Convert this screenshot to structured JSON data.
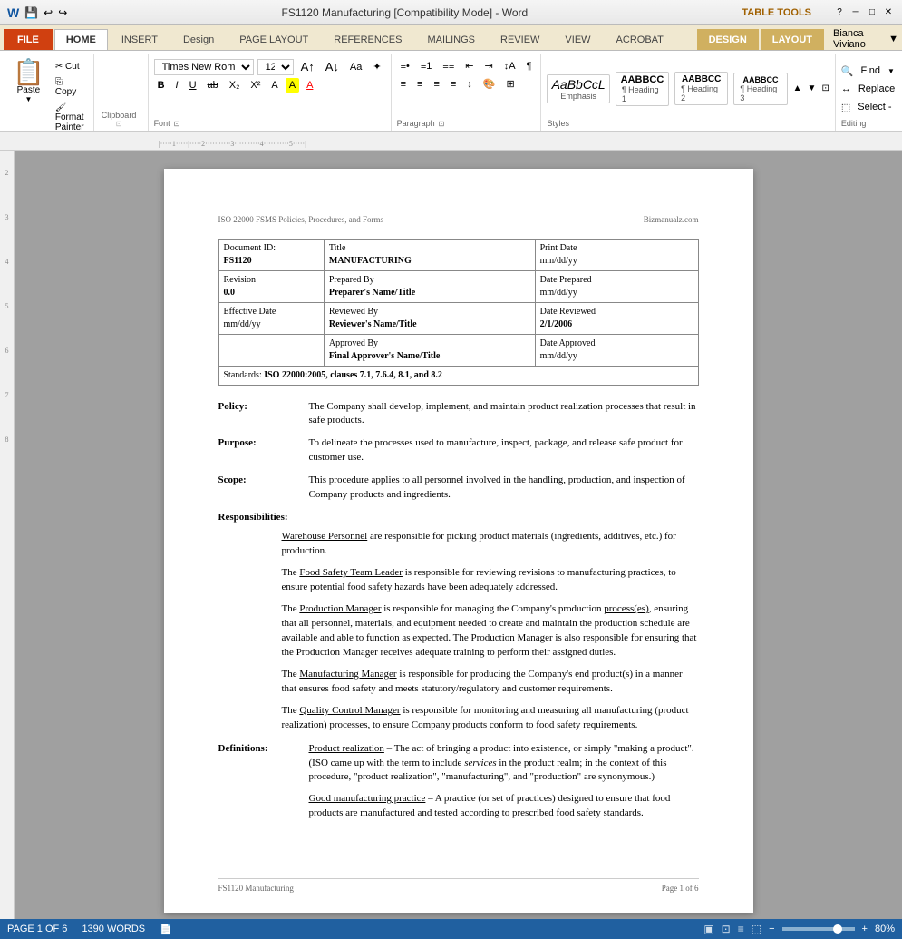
{
  "titlebar": {
    "title": "FS1120 Manufacturing [Compatibility Mode] - Word",
    "table_tools": "TABLE TOOLS"
  },
  "tabs": {
    "file": "FILE",
    "home": "HOME",
    "insert": "INSERT",
    "design": "Design",
    "page_layout": "PAGE LAYOUT",
    "references": "REFERENCES",
    "mailings": "MAILINGS",
    "review": "REVIEW",
    "view": "VIEW",
    "acrobat": "ACROBAT",
    "table_design": "DESIGN",
    "table_layout": "LAYOUT"
  },
  "ribbon": {
    "clipboard": {
      "label": "Clipboard",
      "paste": "Paste",
      "cut": "Cut",
      "copy": "Copy",
      "format_painter": "Format Painter"
    },
    "font": {
      "label": "Font",
      "name": "Times New Roman",
      "size": "12",
      "bold": "B",
      "italic": "I",
      "underline": "U"
    },
    "paragraph": {
      "label": "Paragraph"
    },
    "styles": {
      "label": "Styles",
      "emphasis_label": "Emphasis",
      "heading1_label": "¶ Heading 1",
      "heading2_label": "¶ Heading 2",
      "heading3_label": "¶ Heading 3",
      "emphasis_preview": "AaBbCcL",
      "heading1_preview": "AABBCC",
      "heading2_preview": "AABBCC",
      "heading3_preview": "AABBCC"
    },
    "editing": {
      "label": "Editing",
      "find": "Find",
      "replace": "Replace",
      "select": "Select -"
    }
  },
  "document": {
    "header_left": "ISO 22000 FSMS Policies, Procedures, and Forms",
    "header_right": "Bizmanualz.com",
    "table": {
      "doc_id_label": "Document ID:",
      "doc_id_value": "FS1120",
      "title_label": "Title",
      "title_value": "MANUFACTURING",
      "print_date_label": "Print Date",
      "print_date_value": "mm/dd/yy",
      "revision_label": "Revision",
      "revision_value": "0.0",
      "prepared_by_label": "Prepared By",
      "preparer_label": "Preparer's Name/Title",
      "date_prepared_label": "Date Prepared",
      "date_prepared_value": "mm/dd/yy",
      "effective_date_label": "Effective Date",
      "effective_date_value": "mm/dd/yy",
      "reviewed_by_label": "Reviewed By",
      "reviewer_label": "Reviewer's Name/Title",
      "date_reviewed_label": "Date Reviewed",
      "date_reviewed_value": "2/1/2006",
      "approved_by_label": "Approved By",
      "approver_label": "Final Approver's Name/Title",
      "date_approved_label": "Date Approved",
      "date_approved_value": "mm/dd/yy",
      "standards_label": "Standards:",
      "standards_value": "ISO 22000:2005, clauses 7.1, 7.6.4, 8.1, and 8.2"
    },
    "policy": {
      "label": "Policy:",
      "text": "The Company shall develop, implement, and maintain product realization processes that result in safe products."
    },
    "purpose": {
      "label": "Purpose:",
      "text": "To delineate the processes used to manufacture, inspect, package, and release safe product for customer use."
    },
    "scope": {
      "label": "Scope:",
      "text": "This procedure applies to all personnel involved in the handling, production, and inspection of Company products and ingredients."
    },
    "responsibilities": {
      "label": "Responsibilities:",
      "warehouse": "Warehouse Personnel",
      "warehouse_text": " are responsible for picking product materials (ingredients, additives, etc.) for production.",
      "fst_intro": "The ",
      "fst_name": "Food Safety Team Leader",
      "fst_text": " is responsible for reviewing revisions to manufacturing practices, to ensure potential food safety hazards have been adequately addressed.",
      "pm_intro": "The ",
      "pm_name": "Production Manager",
      "pm_text1": " is responsible for managing the Company's production ",
      "pm_process": "process(es)",
      "pm_text2": ", ensuring that all personnel, materials, and equipment needed to create and maintain the production schedule are available and able to function as expected.  The Production Manager is also responsible for ensuring that the Production Manager receives adequate training to perform their assigned duties.",
      "mm_intro": "The ",
      "mm_name": "Manufacturing Manager",
      "mm_text": " is responsible for producing the Company's end product(s) in a manner that ensures food safety and meets statutory/regulatory and customer requirements.",
      "qcm_intro": "The ",
      "qcm_name": "Quality Control Manager",
      "qcm_text": " is responsible for monitoring and measuring all manufacturing (product realization) processes, to ensure Company products conform to food safety requirements."
    },
    "definitions": {
      "label": "Definitions:",
      "pr_term": "Product realization",
      "pr_text": " – The act of bringing a product into existence, or simply \"making a product\".  (ISO came up with the term to include ",
      "pr_italic": "services",
      "pr_text2": " in the product realm; in the context of this procedure, \"product realization\", \"manufacturing\", and \"production\" are synonymous.)",
      "gmp_term": "Good manufacturing practice",
      "gmp_text": " – A practice (or set of practices) designed to ensure that food products are manufactured and tested according to prescribed food safety standards."
    },
    "footer_left": "FS1120  Manufacturing",
    "footer_right": "Page 1 of 6"
  },
  "statusbar": {
    "page_info": "PAGE 1 OF 6",
    "word_count": "1390 WORDS",
    "zoom": "80%"
  }
}
